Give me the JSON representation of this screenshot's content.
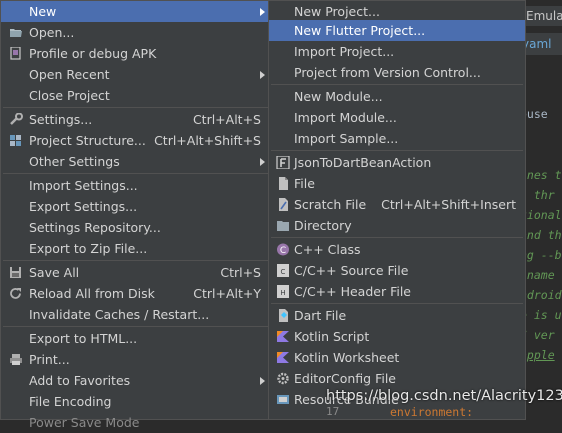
{
  "editor": {
    "tab_top": "Emula",
    "tab_file": "yaml",
    "code_lines": [
      "ouse",
      "ines t",
      "s thr",
      "tional",
      "and th",
      "ng --b",
      "-name",
      "ndroid",
      "e is u",
      "S ver",
      "apple"
    ],
    "line_number": "17",
    "env_text": "environment:"
  },
  "main_menu": {
    "items": [
      {
        "label": "New",
        "shortcut": "",
        "submenu": true
      },
      {
        "label": "Open...",
        "shortcut": "",
        "submenu": false
      },
      {
        "label": "Profile or debug APK",
        "shortcut": "",
        "submenu": false
      },
      {
        "label": "Open Recent",
        "shortcut": "",
        "submenu": true
      },
      {
        "label": "Close Project",
        "shortcut": "",
        "submenu": false
      },
      {
        "label": "Settings...",
        "shortcut": "Ctrl+Alt+S",
        "submenu": false
      },
      {
        "label": "Project Structure...",
        "shortcut": "Ctrl+Alt+Shift+S",
        "submenu": false
      },
      {
        "label": "Other Settings",
        "shortcut": "",
        "submenu": true
      },
      {
        "label": "Import Settings...",
        "shortcut": "",
        "submenu": false
      },
      {
        "label": "Export Settings...",
        "shortcut": "",
        "submenu": false
      },
      {
        "label": "Settings Repository...",
        "shortcut": "",
        "submenu": false
      },
      {
        "label": "Export to Zip File...",
        "shortcut": "",
        "submenu": false
      },
      {
        "label": "Save All",
        "shortcut": "Ctrl+S",
        "submenu": false
      },
      {
        "label": "Reload All from Disk",
        "shortcut": "Ctrl+Alt+Y",
        "submenu": false
      },
      {
        "label": "Invalidate Caches / Restart...",
        "shortcut": "",
        "submenu": false
      },
      {
        "label": "Export to HTML...",
        "shortcut": "",
        "submenu": false
      },
      {
        "label": "Print...",
        "shortcut": "",
        "submenu": false
      },
      {
        "label": "Add to Favorites",
        "shortcut": "",
        "submenu": true
      },
      {
        "label": "File Encoding",
        "shortcut": "",
        "submenu": false
      },
      {
        "label": "Power Save Mode",
        "shortcut": "",
        "submenu": false
      }
    ]
  },
  "new_submenu": {
    "items": [
      {
        "label": "New Project...",
        "shortcut": ""
      },
      {
        "label": "New Flutter Project...",
        "shortcut": ""
      },
      {
        "label": "Import Project...",
        "shortcut": ""
      },
      {
        "label": "Project from Version Control...",
        "shortcut": ""
      },
      {
        "label": "New Module...",
        "shortcut": ""
      },
      {
        "label": "Import Module...",
        "shortcut": ""
      },
      {
        "label": "Import Sample...",
        "shortcut": ""
      },
      {
        "label": "JsonToDartBeanAction",
        "shortcut": ""
      },
      {
        "label": "File",
        "shortcut": ""
      },
      {
        "label": "Scratch File",
        "shortcut": "Ctrl+Alt+Shift+Insert"
      },
      {
        "label": "Directory",
        "shortcut": ""
      },
      {
        "label": "C++ Class",
        "shortcut": ""
      },
      {
        "label": "C/C++ Source File",
        "shortcut": ""
      },
      {
        "label": "C/C++ Header File",
        "shortcut": ""
      },
      {
        "label": "Dart File",
        "shortcut": ""
      },
      {
        "label": "Kotlin Script",
        "shortcut": ""
      },
      {
        "label": "Kotlin Worksheet",
        "shortcut": ""
      },
      {
        "label": "EditorConfig File",
        "shortcut": ""
      },
      {
        "label": "Resource Bundle",
        "shortcut": ""
      }
    ]
  },
  "watermark": "https://blog.csdn.net/Alacrity123",
  "colors": {
    "highlight": "#4b6eaf",
    "menu_bg": "#3c3f41",
    "separator": "#515151"
  }
}
